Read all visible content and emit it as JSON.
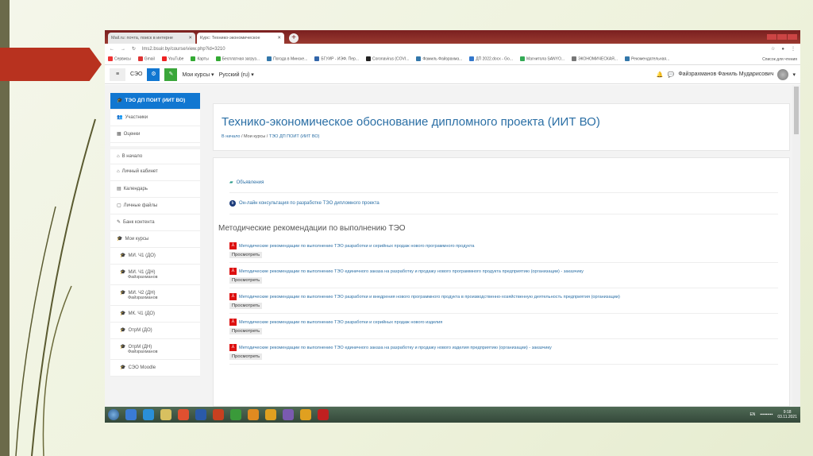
{
  "browser": {
    "tabs": [
      {
        "label": "Mail.ru: почта, поиск в интерне"
      },
      {
        "label": "Курс: Технико-экономическое"
      }
    ],
    "url": "lms2.bsuir.by/course/view.php?id=3210",
    "bookmarks": [
      "Сервисы",
      "Gmail",
      "YouTube",
      "Карты",
      "Бесплатная загруз...",
      "Погода в Минске...",
      "БГУИР - ИЭФ. Пер...",
      "Coronavirus (COVI...",
      "Фамиль Файзрахма...",
      "ДП 2022.docx - Go...",
      "Магнитола SANYO...",
      "ЭКОНОМИЧЕСКАЯ...",
      "Рекомендательная..."
    ],
    "reading_list": "Список для чтения"
  },
  "navbar": {
    "site": "СЭО",
    "my_courses": "Мои курсы ▾",
    "language": "Русский (ru) ▾",
    "user": "Файзрахманов Фаниль Мударисович"
  },
  "sidebar": {
    "items": [
      {
        "icon": "graduation-cap-icon",
        "glyph": "🎓",
        "label": "ТЭО ДП ПОИТ (ИИТ ВО)"
      },
      {
        "icon": "users-icon",
        "glyph": "👥",
        "label": "Участники"
      },
      {
        "icon": "grades-icon",
        "glyph": "▦",
        "label": "Оценки"
      },
      {
        "icon": "home-icon",
        "glyph": "⌂",
        "label": "В начало"
      },
      {
        "icon": "dashboard-icon",
        "glyph": "⌂",
        "label": "Личный кабинет"
      },
      {
        "icon": "calendar-icon",
        "glyph": "▤",
        "label": "Календарь"
      },
      {
        "icon": "file-icon",
        "glyph": "▢",
        "label": "Личные файлы"
      },
      {
        "icon": "pencil-icon",
        "glyph": "✎",
        "label": "Банк контента"
      },
      {
        "icon": "graduation-cap-icon",
        "glyph": "🎓",
        "label": "Мои курсы"
      },
      {
        "icon": "graduation-cap-icon",
        "glyph": "🎓",
        "label": "МИ. Ч1 (ДО)"
      },
      {
        "icon": "graduation-cap-icon",
        "glyph": "🎓",
        "label": "МИ. Ч1 (ДН)",
        "sub": "Файзрахманов"
      },
      {
        "icon": "graduation-cap-icon",
        "glyph": "🎓",
        "label": "МИ. Ч2 (ДН)",
        "sub": "Файзрахманов"
      },
      {
        "icon": "graduation-cap-icon",
        "glyph": "🎓",
        "label": "МК. Ч1 (ДО)"
      },
      {
        "icon": "graduation-cap-icon",
        "glyph": "🎓",
        "label": "ОтрМ (ДО)"
      },
      {
        "icon": "graduation-cap-icon",
        "glyph": "🎓",
        "label": "ОтрМ (ДН)",
        "sub": "Файзрахманов"
      },
      {
        "icon": "graduation-cap-icon",
        "glyph": "🎓",
        "label": "СЭО Moodle"
      }
    ]
  },
  "header": {
    "title": "Технико-экономическое обоснование дипломного проекта (ИИТ ВО)",
    "breadcrumb": [
      "В начало",
      "Мои курсы",
      "ТЭО ДП ПОИТ (ИИТ ВО)"
    ]
  },
  "activities": [
    {
      "label": "Объявления"
    },
    {
      "label": "Он-лайн консультация по разработке ТЭО дипломного проекта"
    }
  ],
  "section": {
    "title": "Методические рекомендации по выполнению ТЭО",
    "view_label": "Просмотреть",
    "resources": [
      "Методические рекомендации по выполнению ТЭО разработки и серийных продаж нового программного продукта",
      "Методические рекомендации по выполнению ТЭО единичного заказа на разработку и продажу нового программного продукта предприятию (организации) - заказчику",
      "Методические рекомендации по выполнению ТЭО разработки и внедрения нового программного продукта в производственно-хозяйственную деятельность предприятия (организации)",
      "Методические рекомендации по выполнению ТЭО разработки и серийных продаж нового изделия",
      "Методические рекомендации по выполнению ТЭО единичного заказа на разработку и продажу нового изделия предприятию (организации) - заказчику"
    ]
  },
  "taskbar": {
    "lang": "EN",
    "time": "9:18",
    "date": "03.11.2021",
    "colors": [
      "#3a7bd5",
      "#2a8fd8",
      "#d8c060",
      "#e05030",
      "#2a5aa8",
      "#c84020",
      "#3a9a3a",
      "#e08a20",
      "#e0a020",
      "#7a5ab0",
      "#e0a020",
      "#c02020"
    ]
  }
}
